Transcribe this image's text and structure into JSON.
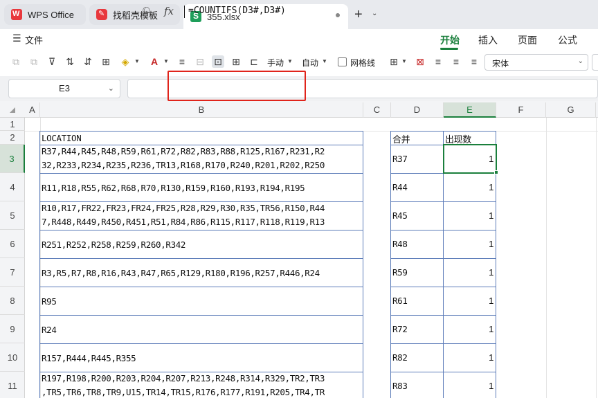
{
  "tabs": [
    {
      "label": "WPS Office"
    },
    {
      "label": "找稻壳模板"
    },
    {
      "label": "355.xlsx"
    }
  ],
  "menu": {
    "file_label": "文件",
    "ribbon_tabs": [
      "开始",
      "插入",
      "页面",
      "公式"
    ]
  },
  "toolbar": {
    "manual_label": "手动",
    "auto_label": "自动",
    "gridlines_label": "网格线",
    "font_name": "宋体"
  },
  "formula_bar": {
    "name_box": "E3",
    "formula": "=COUNTIFS(D3#,D3#)"
  },
  "columns": [
    "A",
    "B",
    "C",
    "D",
    "E",
    "F",
    "G"
  ],
  "rows": [
    "1",
    "2",
    "3",
    "4",
    "5",
    "6",
    "7",
    "8",
    "9",
    "10",
    "11"
  ],
  "cells": {
    "B2": "LOCATION",
    "D2": "合并",
    "E2": "出现数",
    "B3a": "R37,R44,R45,R48,R59,R61,R72,R82,R83,R88,R125,R167,R231,R2",
    "B3b": "32,R233,R234,R235,R236,TR13,R168,R170,R240,R201,R202,R250",
    "B4": "R11,R18,R55,R62,R68,R70,R130,R159,R160,R193,R194,R195",
    "B5a": "R10,R17,FR22,FR23,FR24,FR25,R28,R29,R30,R35,TR56,R150,R44",
    "B5b": "7,R448,R449,R450,R451,R51,R84,R86,R115,R117,R118,R119,R13",
    "B6": "R251,R252,R258,R259,R260,R342",
    "B7": "R3,R5,R7,R8,R16,R43,R47,R65,R129,R180,R196,R257,R446,R24",
    "B8": "R95",
    "B9": "R24",
    "B10": "R157,R444,R445,R355",
    "B11a": "R197,R198,R200,R203,R204,R207,R213,R248,R314,R329,TR2,TR3",
    "B11b": ",TR5,TR6,TR8,TR9,U15,TR14,TR15,R176,R177,R191,R205,TR4,TR",
    "D": [
      "R37",
      "R44",
      "R45",
      "R48",
      "R59",
      "R61",
      "R72",
      "R82",
      "R83"
    ],
    "E": [
      "1",
      "1",
      "1",
      "1",
      "1",
      "1",
      "1",
      "1",
      "1"
    ]
  },
  "colors": {
    "accent_green": "#1a7f3c",
    "highlight_red": "#e0241b",
    "table_border_blue": "#5b7bb8"
  }
}
